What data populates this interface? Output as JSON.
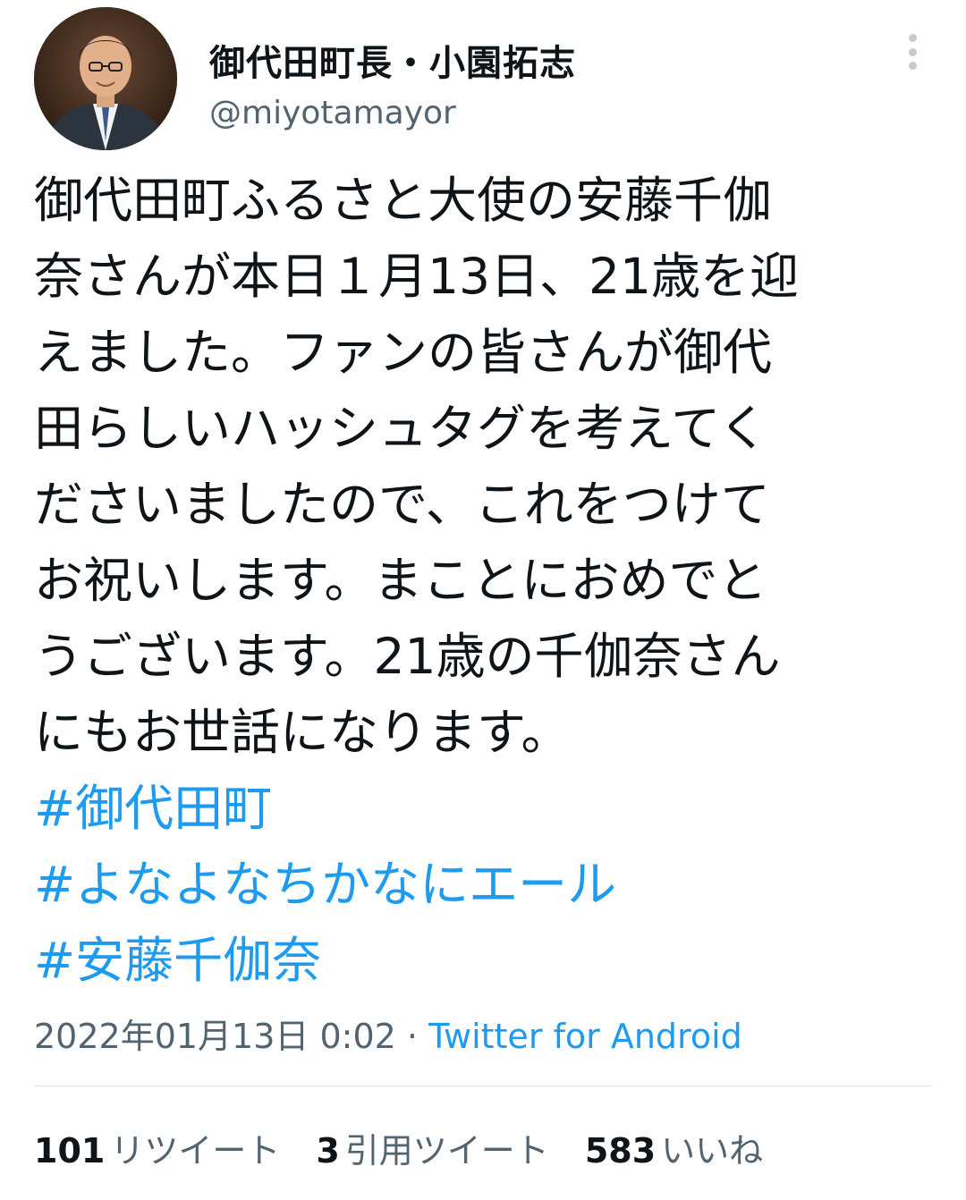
{
  "author": {
    "display_name": "御代田町長・小園拓志",
    "handle": "@miyotamayor"
  },
  "tweet": {
    "lines": [
      "御代田町ふるさと大使の安藤千伽",
      "奈さんが本日１月13日、21歳を迎",
      "えました。ファンの皆さんが御代",
      "田らしいハッシュタグを考えてく",
      "ださいましたので、これをつけて",
      "お祝いします。まことにおめでと",
      "うございます。21歳の千伽奈さん",
      "にもお世話になります。"
    ],
    "hashtags": [
      "#御代田町",
      "#よなよなちかなにエール",
      "#安藤千伽奈"
    ]
  },
  "meta": {
    "timestamp": "2022年01月13日 0:02",
    "separator": " · ",
    "source": "Twitter for Android"
  },
  "stats": {
    "retweets": {
      "count": "101",
      "label": "リツイート"
    },
    "quotes": {
      "count": "3",
      "label": "引用ツイート"
    },
    "likes": {
      "count": "583",
      "label": "いいね"
    }
  },
  "colors": {
    "link": "#1d9bf0",
    "secondary_text": "#536471",
    "primary_text": "#0f1419"
  }
}
